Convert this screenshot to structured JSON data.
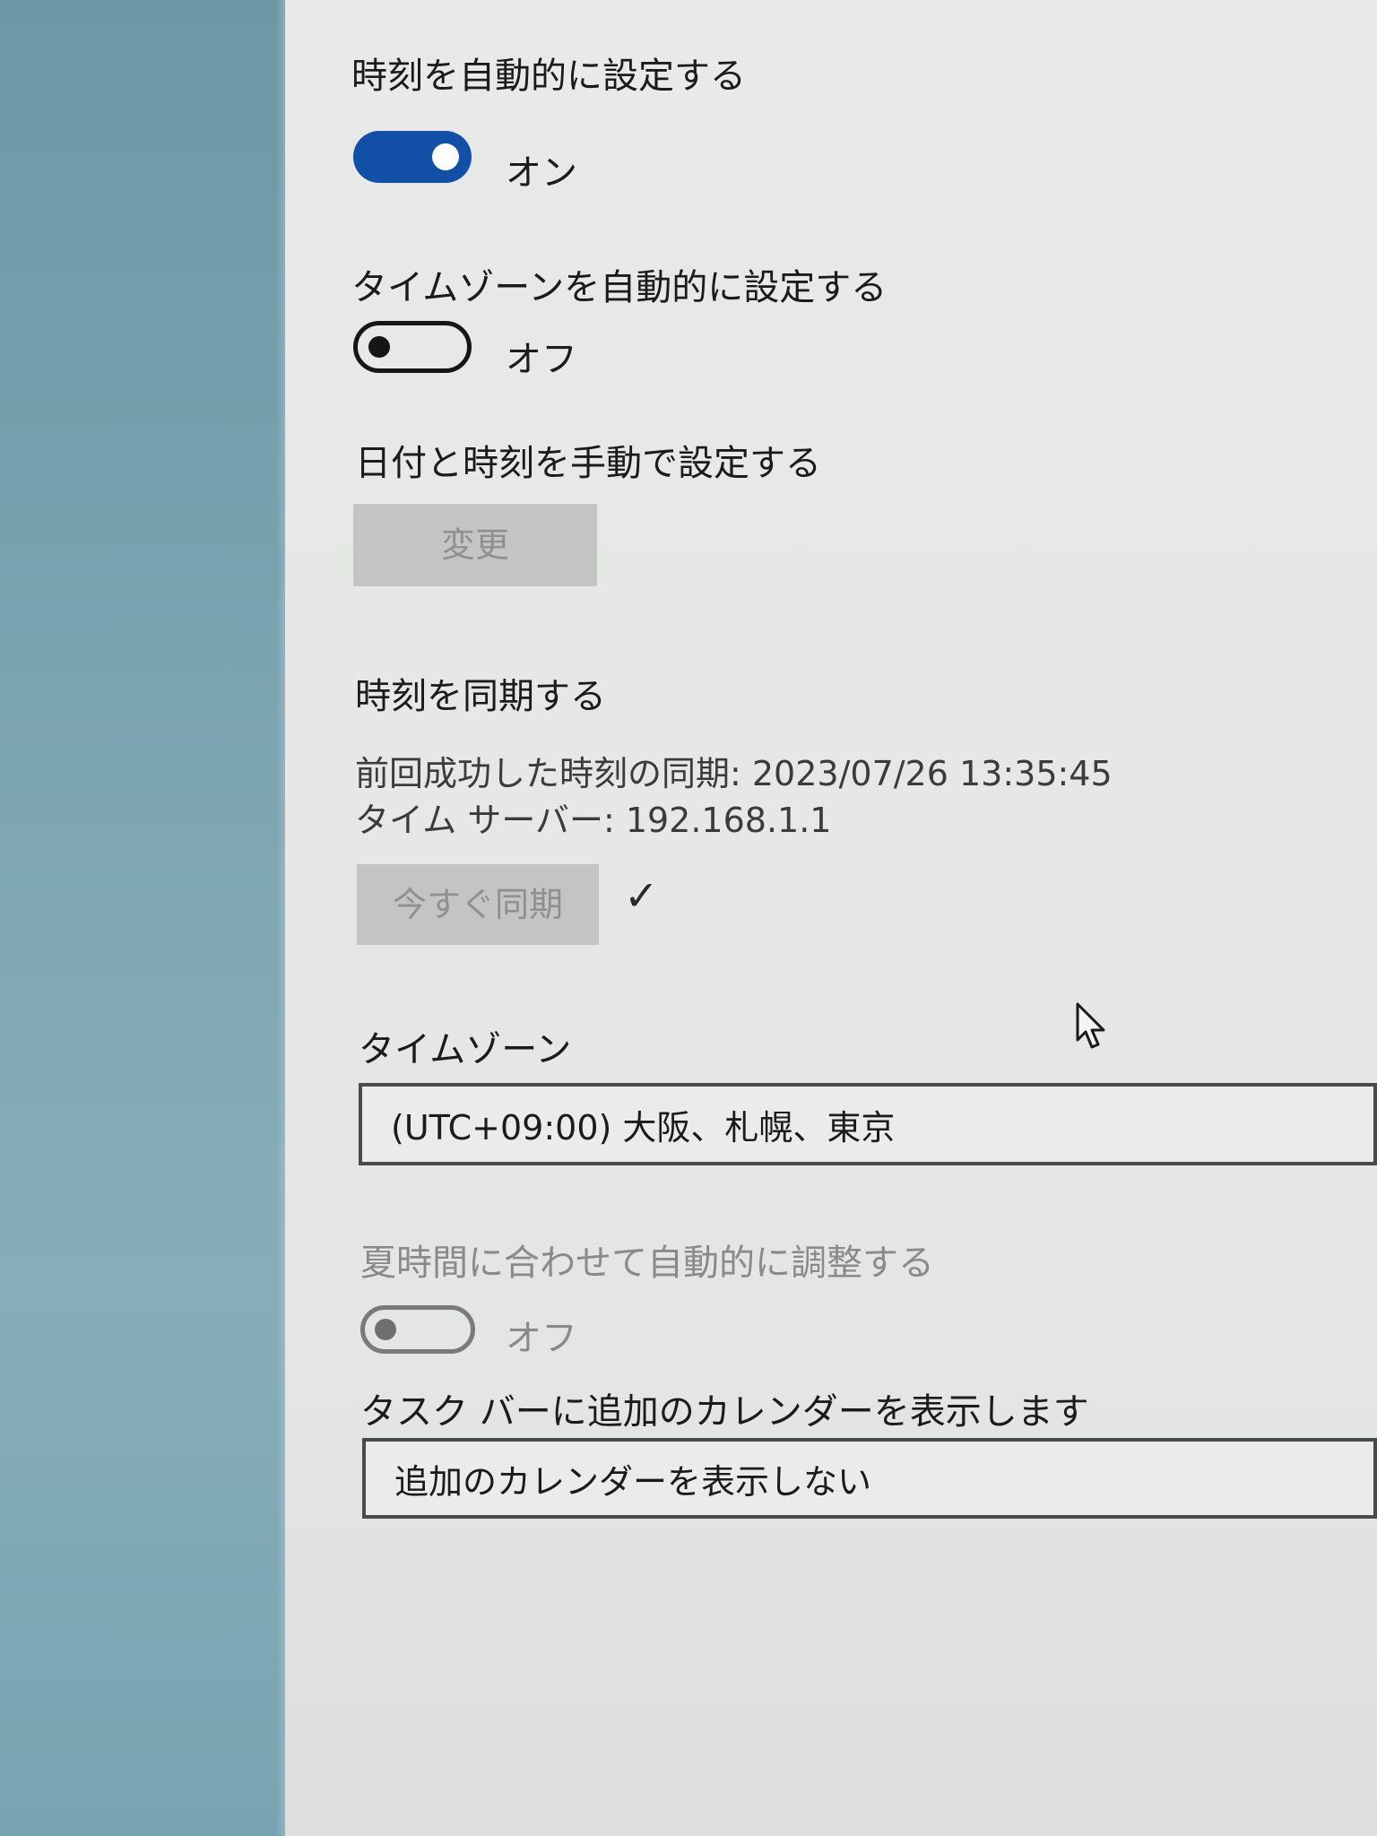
{
  "settings": {
    "set_time_auto": {
      "label": "時刻を自動的に設定する",
      "state": "オン"
    },
    "set_timezone_auto": {
      "label": "タイムゾーンを自動的に設定する",
      "state": "オフ"
    },
    "manual": {
      "label": "日付と時刻を手動で設定する",
      "button": "変更"
    },
    "sync": {
      "label": "時刻を同期する",
      "last_sync": "前回成功した時刻の同期: 2023/07/26 13:35:45",
      "server": "タイム サーバー: 192.168.1.1",
      "button": "今すぐ同期",
      "check": "✓"
    },
    "timezone": {
      "label": "タイムゾーン",
      "value": "(UTC+09:00) 大阪、札幌、東京"
    },
    "dst": {
      "label": "夏時間に合わせて自動的に調整する",
      "state": "オフ"
    },
    "calendar": {
      "label": "タスク バーに追加のカレンダーを表示します",
      "value": "追加のカレンダーを表示しない"
    }
  },
  "colors": {
    "accent": "#1250a7",
    "panel_bg": "#e8e9e8",
    "left_bg": "#7aa3b0"
  }
}
